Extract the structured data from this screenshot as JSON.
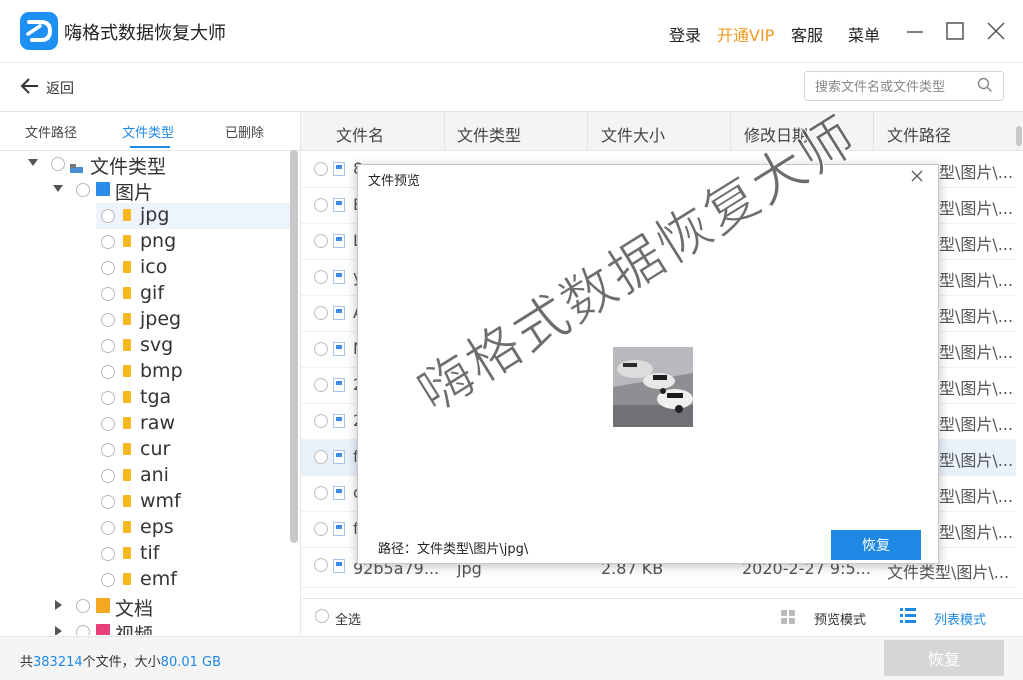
{
  "app": {
    "title": "嗨格式数据恢复大师",
    "login": "登录",
    "vip": "开通VIP",
    "service": "客服",
    "menu": "菜单",
    "accent_color": "#1e88e5",
    "vip_color": "#f19a1d"
  },
  "toolbar": {
    "back_label": "返回",
    "search_placeholder": "搜索文件名或文件类型"
  },
  "left_panel": {
    "tabs": [
      "文件路径",
      "文件类型",
      "已删除"
    ],
    "active_tab": "文件类型",
    "tree": {
      "root": "文件类型",
      "images": "图片",
      "image_types": [
        "jpg",
        "png",
        "ico",
        "gif",
        "jpeg",
        "svg",
        "bmp",
        "tga",
        "raw",
        "cur",
        "ani",
        "wmf",
        "eps",
        "tif",
        "emf"
      ],
      "selected": "jpg",
      "documents": "文档",
      "videos": "视频"
    }
  },
  "table": {
    "columns": [
      "文件名",
      "文件类型",
      "文件大小",
      "修改日期",
      "文件路径"
    ],
    "rows": [
      {
        "name_initial": "8",
        "path_tail": "型\\图片\\..."
      },
      {
        "name_initial": "E",
        "path_tail": "型\\图片\\..."
      },
      {
        "name_initial": "L",
        "path_tail": "型\\图片\\..."
      },
      {
        "name_initial": "y",
        "path_tail": "型\\图片\\..."
      },
      {
        "name_initial": "A",
        "path_tail": "型\\图片\\..."
      },
      {
        "name_initial": "M",
        "path_tail": "型\\图片\\..."
      },
      {
        "name_initial": "2",
        "path_tail": "型\\图片\\..."
      },
      {
        "name_initial": "2",
        "path_tail": "型\\图片\\..."
      },
      {
        "name_initial": "f",
        "path_tail": "型\\图片\\..."
      },
      {
        "name_initial": "c",
        "path_tail": "型\\图片\\..."
      },
      {
        "name_initial": "f",
        "path_tail": "型\\图片\\..."
      }
    ],
    "last_row": {
      "name": "92b5a79...",
      "type": "jpg",
      "size": "2.87 KB",
      "date": "2020-2-27 9:5...",
      "path": "文件类型\\图片\\..."
    },
    "selected_row_index": 8
  },
  "selection_bar": {
    "select_all": "全选",
    "preview_mode": "预览模式",
    "list_mode": "列表模式"
  },
  "status": {
    "prefix": "共",
    "file_count": "383214",
    "middle": "个文件，大小",
    "total_size": "80.01 GB",
    "recover_button": "恢复"
  },
  "dialog": {
    "title": "文件预览",
    "path_label": "路径：",
    "path_value": "文件类型\\图片\\jpg\\",
    "recover_button": "恢复",
    "watermark": "嗨格式数据恢复大师"
  }
}
